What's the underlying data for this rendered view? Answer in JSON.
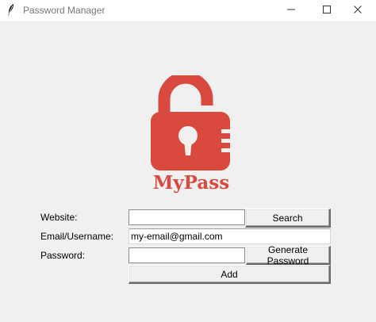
{
  "window": {
    "title": "Password Manager"
  },
  "titlebar_controls": [
    "minimize-icon",
    "maximize-icon",
    "close-icon"
  ],
  "logo": {
    "text": "MyPass",
    "icon": "open-padlock-icon",
    "color": "#d9493e"
  },
  "form": {
    "website_label": "Website:",
    "website_value": "",
    "email_label": "Email/Username:",
    "email_value": "my-email@gmail.com",
    "password_label": "Password:",
    "password_value": ""
  },
  "buttons": {
    "search": "Search",
    "generate": "Generate Password",
    "add": "Add"
  }
}
